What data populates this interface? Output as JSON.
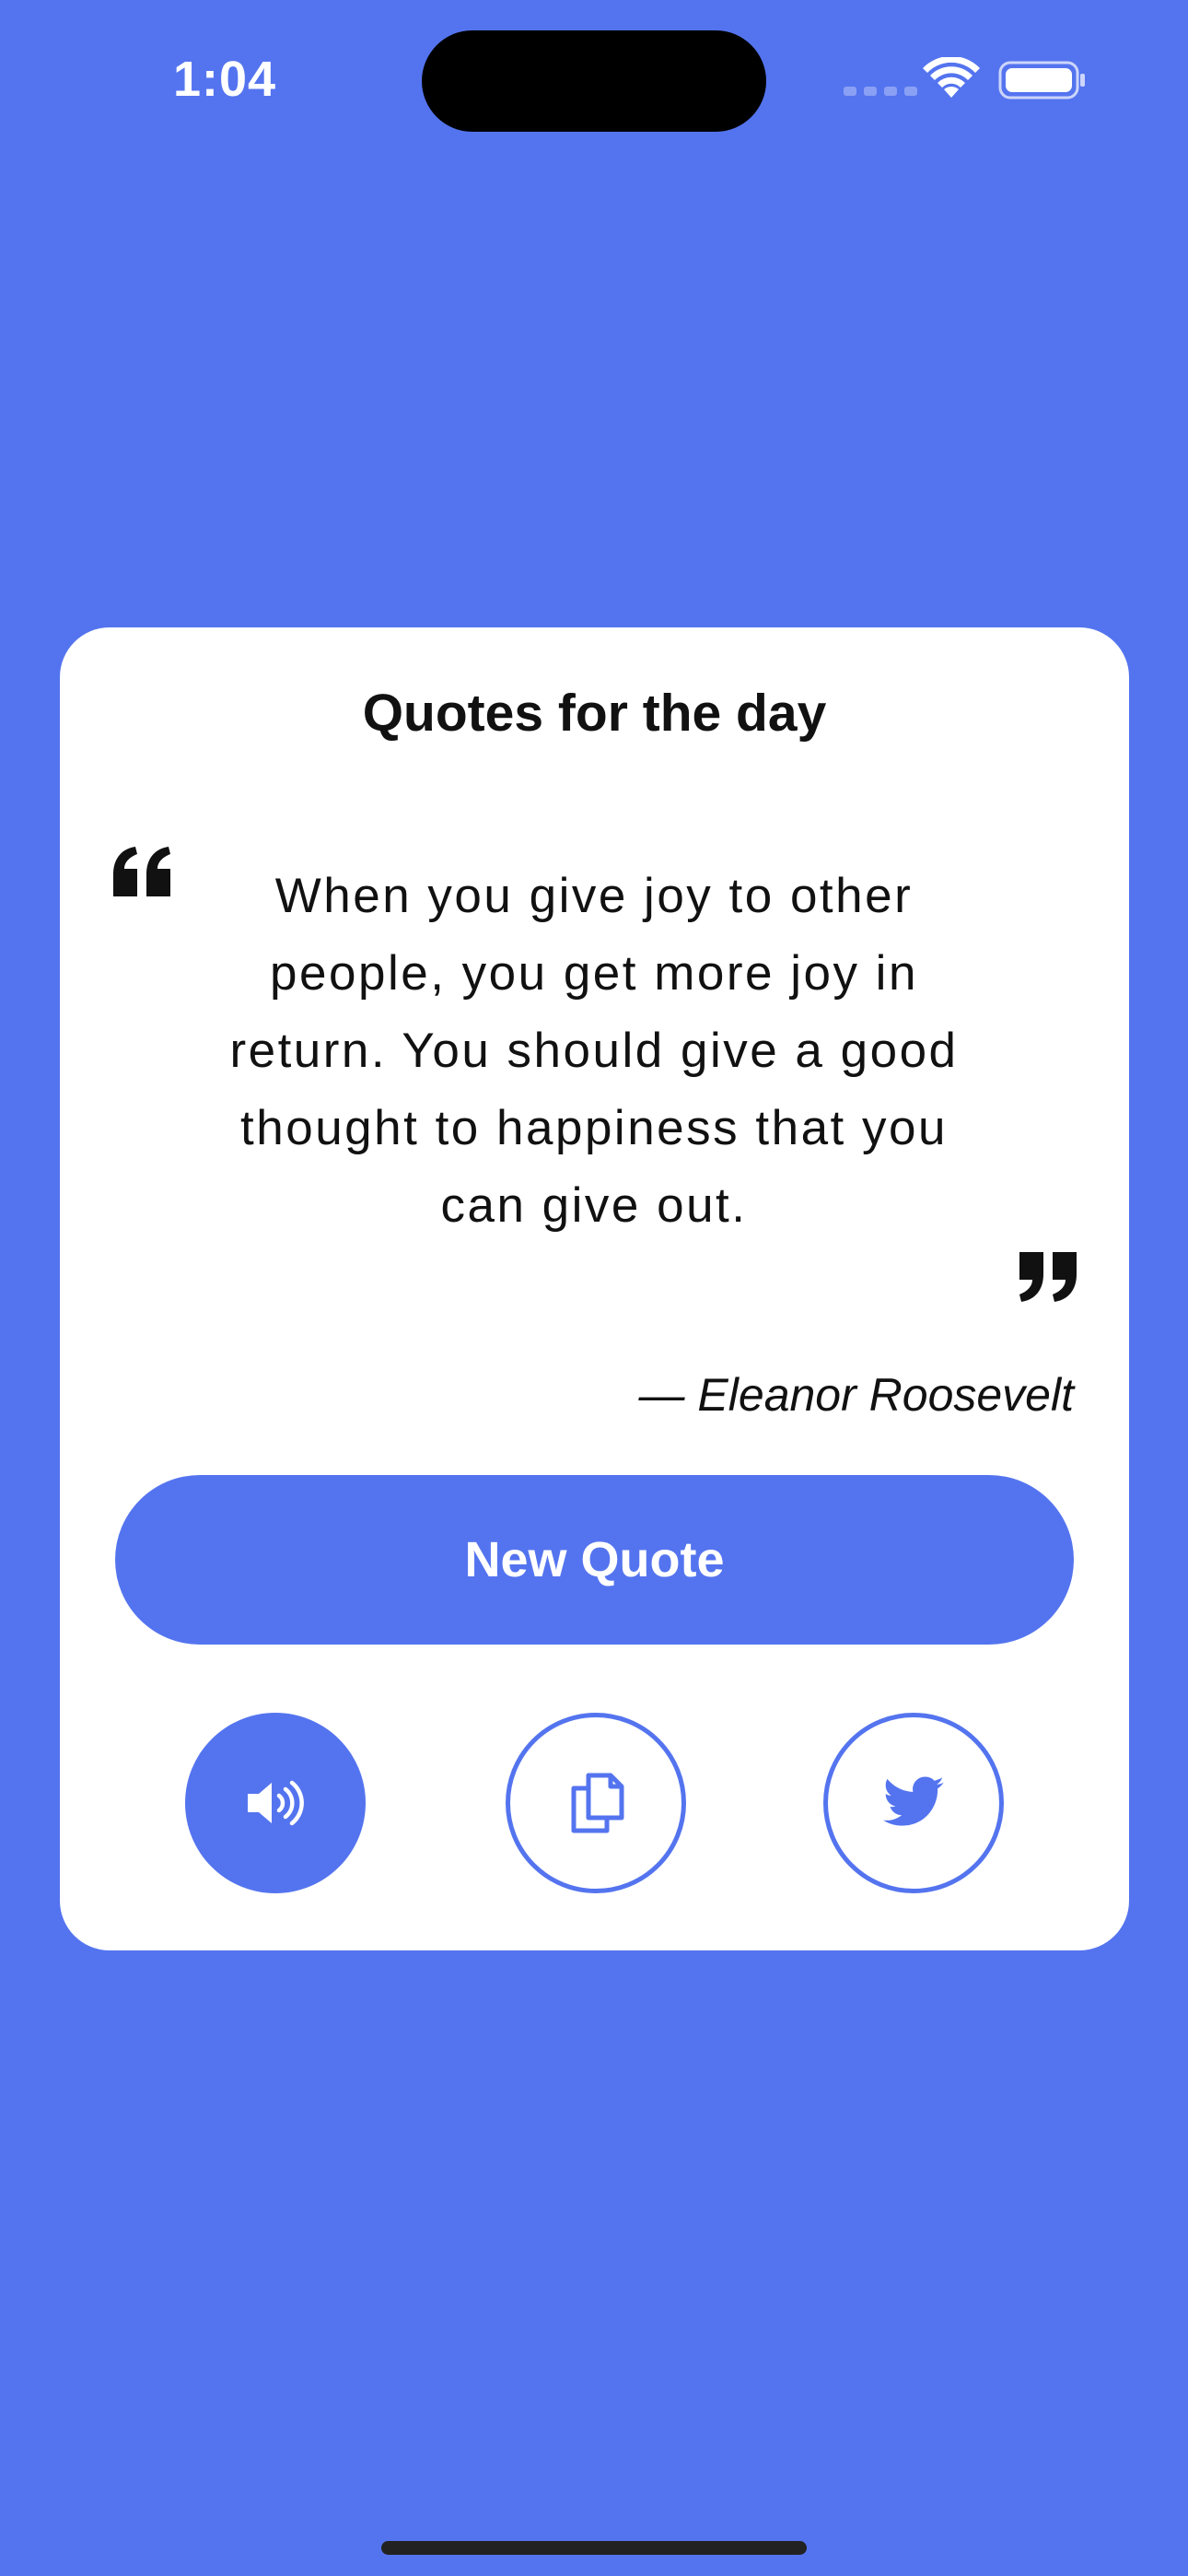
{
  "status_bar": {
    "time": "1:04"
  },
  "card": {
    "title": "Quotes for the day",
    "quote_text": "When you give joy to other people, you get more joy in return. You should give a good thought to happiness that you can give out.",
    "author": "— Eleanor Roosevelt",
    "new_quote_label": "New Quote",
    "actions": [
      {
        "name": "speak",
        "icon": "speaker-icon"
      },
      {
        "name": "copy",
        "icon": "copy-icon"
      },
      {
        "name": "tweet",
        "icon": "twitter-icon"
      }
    ]
  },
  "colors": {
    "background": "#5474ef",
    "card": "#ffffff",
    "accent": "#5474ef",
    "text": "#111111"
  }
}
